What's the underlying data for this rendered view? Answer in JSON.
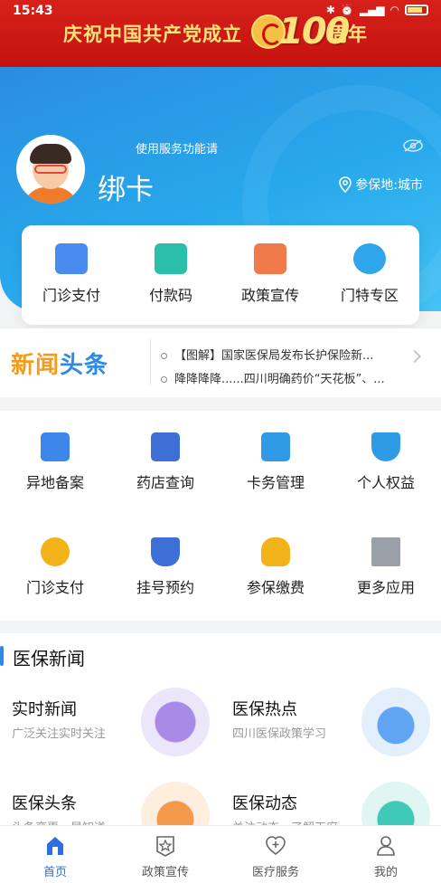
{
  "status_bar": {
    "time": "15:43",
    "icons": [
      "bluetooth-icon",
      "alarm-icon",
      "signal-icon",
      "wifi-icon",
      "battery-icon"
    ]
  },
  "banner": {
    "text": "庆祝中国共产党成立",
    "number": "100",
    "suffix": "周年"
  },
  "profile": {
    "bind_hint": "使用服务功能请",
    "bind_action": "绑卡",
    "location_label": "参保地:城市"
  },
  "quick_actions": [
    {
      "label": "门诊支付",
      "icon": "wallet-icon",
      "color": "#4a8bf0"
    },
    {
      "label": "付款码",
      "icon": "barcode-icon",
      "color": "#2bbfa9"
    },
    {
      "label": "政策宣传",
      "icon": "star-card-icon",
      "color": "#f07a4a"
    },
    {
      "label": "门特专区",
      "icon": "medical-cross-icon",
      "color": "#2fa6ec"
    }
  ],
  "ticker": {
    "logo_a": "新闻",
    "logo_b": "头条",
    "items": [
      "【图解】国家医保局发布长护保险新...",
      "降降降降......四川明确药价“天花板”、..."
    ]
  },
  "services": [
    {
      "label": "异地备案",
      "icon": "edit-doc-icon",
      "color": "#3d86ea"
    },
    {
      "label": "药店查询",
      "icon": "store-icon",
      "color": "#3d6fd6"
    },
    {
      "label": "卡务管理",
      "icon": "card-icon",
      "color": "#2f9be6"
    },
    {
      "label": "个人权益",
      "icon": "badge-icon",
      "color": "#2f9be6"
    },
    {
      "label": "门诊支付",
      "icon": "coin-plus-icon",
      "color": "#f2b319"
    },
    {
      "label": "挂号预约",
      "icon": "registration-icon",
      "color": "#3d6fd6"
    },
    {
      "label": "参保缴费",
      "icon": "money-bag-icon",
      "color": "#f2b319"
    },
    {
      "label": "更多应用",
      "icon": "plus-square-icon",
      "color": "#9aa0a8"
    }
  ],
  "news_section": {
    "title": "医保新闻",
    "cards": [
      {
        "title": "实时新闻",
        "subtitle": "广泛关注实时关注",
        "icon": "stopwatch-icon",
        "color": "#a98be6"
      },
      {
        "title": "医保热点",
        "subtitle": "四川医保政策学习",
        "icon": "flame-icon",
        "color": "#5fa5f3"
      },
      {
        "title": "医保头条",
        "subtitle": "头条变更，早知道",
        "icon": "party-emblem-icon",
        "color": "#f39a4a"
      },
      {
        "title": "医保动态",
        "subtitle": "关注动态，了解天府",
        "icon": "heart-icon",
        "color": "#3fc9b8"
      }
    ]
  },
  "bottom_nav": [
    {
      "label": "首页",
      "icon": "home-icon",
      "active": true
    },
    {
      "label": "政策宣传",
      "icon": "star-badge-icon",
      "active": false
    },
    {
      "label": "医疗服务",
      "icon": "heart-plus-icon",
      "active": false
    },
    {
      "label": "我的",
      "icon": "user-icon",
      "active": false
    }
  ]
}
